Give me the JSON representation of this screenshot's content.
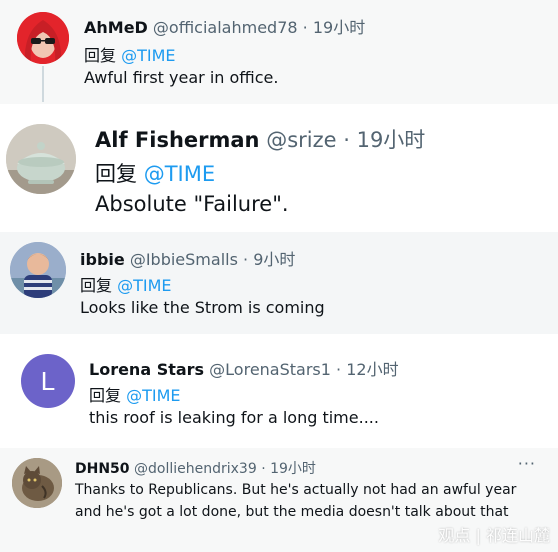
{
  "reply_word": "回复",
  "replies": [
    {
      "avatar": "red-haired-sunglasses-avatar",
      "name": "AhMeD",
      "handle": "@officialahmed78",
      "time": "· 19小时",
      "mention": "@TIME",
      "text": "Awful first year in office."
    },
    {
      "avatar": "porcelain-bowl-avatar",
      "name": "Alf Fisherman",
      "handle": "@srize",
      "time": "· 19小时",
      "mention": "@TIME",
      "text": "Absolute \"Failure\"."
    },
    {
      "avatar": "child-photo-avatar",
      "name": "ibbie",
      "handle": "@IbbieSmalls",
      "time": "· 9小时",
      "mention": "@TIME",
      "text": "Looks like the Strom is coming"
    },
    {
      "avatar": "letter-avatar",
      "avatar_letter": "L",
      "name": "Lorena Stars",
      "handle": "@LorenaStars1",
      "time": "· 12小时",
      "mention": "@TIME",
      "text": "this roof is leaking for a long time...."
    },
    {
      "avatar": "cat-photo-avatar",
      "name": "DHN50",
      "handle": "@dolliehendrix39",
      "time": "· 19小时",
      "more": "···",
      "text_line1": "Thanks to Republicans. But he's actually not had an awful year",
      "text_line2": "and he's got a lot done, but the media doesn't talk about that"
    }
  ],
  "watermark": "观点 | 祁连山麓",
  "colors": {
    "mention": "#1d9bf0",
    "handle": "#536471",
    "letter_avatar": "#6c63c9"
  }
}
